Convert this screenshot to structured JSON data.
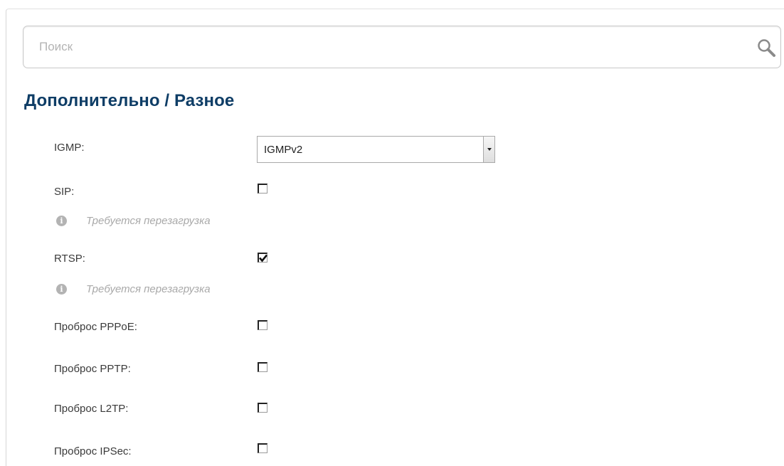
{
  "search": {
    "placeholder": "Поиск",
    "value": ""
  },
  "page": {
    "title": "Дополнительно /  Разное"
  },
  "settings": {
    "igmp": {
      "label": "IGMP:",
      "value": "IGMPv2"
    },
    "sip": {
      "label": "SIP:",
      "checked": false,
      "hint": "Требуется перезагрузка"
    },
    "rtsp": {
      "label": "RTSP:",
      "checked": true,
      "hint": "Требуется перезагрузка"
    },
    "pppoe": {
      "label": "Проброс PPPoE:",
      "checked": false
    },
    "pptp": {
      "label": "Проброс PPTP:",
      "checked": false
    },
    "l2tp": {
      "label": "Проброс L2TP:",
      "checked": false
    },
    "ipsec": {
      "label": "Проброс IPSec:",
      "checked": false
    }
  },
  "icons": {
    "search": "search-icon",
    "hint": "info-icon"
  },
  "colors": {
    "title": "#0e3d66",
    "hint": "#a9a9a9",
    "label": "#3a3a3a"
  }
}
